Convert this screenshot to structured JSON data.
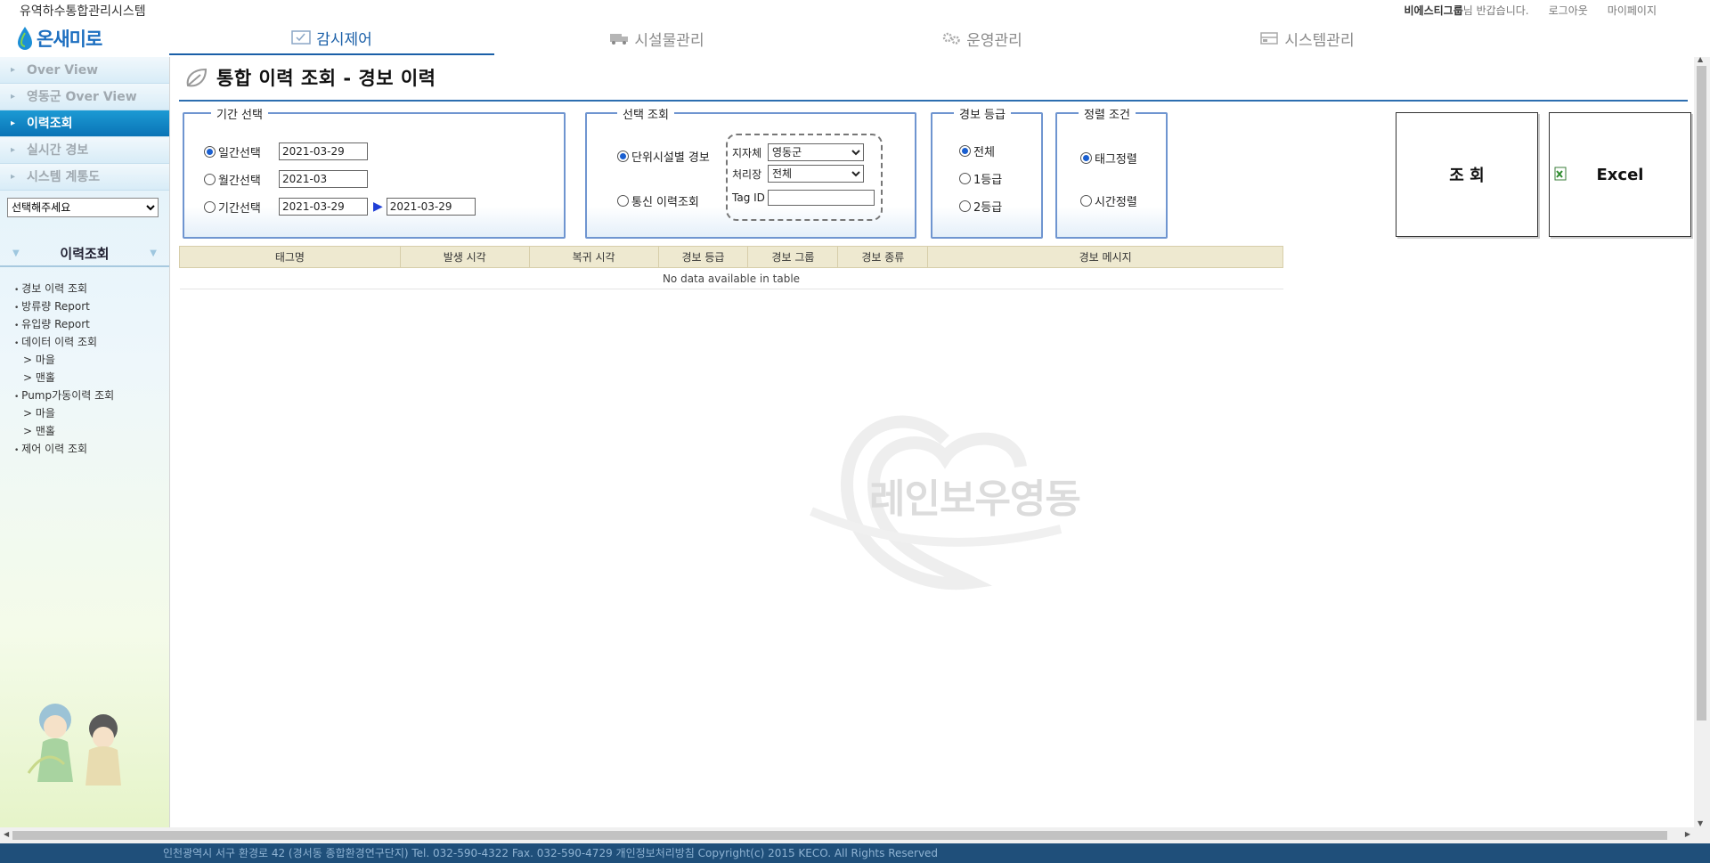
{
  "header": {
    "system_title": "유역하수통합관리시스템",
    "greeting_name": "비에스티그룹",
    "greeting_suffix": "님 반갑습니다.",
    "logout": "로그아웃",
    "mypage": "마이페이지",
    "logo_text": "온새미로"
  },
  "nav": {
    "tabs": [
      {
        "label": "감시제어",
        "icon": "monitor-check-icon",
        "active": true
      },
      {
        "label": "시설물관리",
        "icon": "truck-icon",
        "active": false
      },
      {
        "label": "운영관리",
        "icon": "gears-icon",
        "active": false
      },
      {
        "label": "시스템관리",
        "icon": "server-icon",
        "active": false
      }
    ]
  },
  "sidebar": {
    "items": [
      {
        "label": "Over View"
      },
      {
        "label": "영동군 Over View"
      },
      {
        "label": "이력조회"
      },
      {
        "label": "실시간 경보"
      },
      {
        "label": "시스템 계통도"
      }
    ],
    "select_value": "선택해주세요",
    "section_title": "이력조회",
    "links": [
      {
        "label": "경보 이력 조회",
        "type": "main"
      },
      {
        "label": "방류량 Report",
        "type": "main"
      },
      {
        "label": "유입량 Report",
        "type": "main"
      },
      {
        "label": "데이터 이력 조회",
        "type": "main"
      },
      {
        "label": "> 마을",
        "type": "sub"
      },
      {
        "label": "> 맨홀",
        "type": "sub"
      },
      {
        "label": "Pump가동이력 조회",
        "type": "main"
      },
      {
        "label": "> 마을",
        "type": "sub"
      },
      {
        "label": "> 맨홀",
        "type": "sub"
      },
      {
        "label": "제어 이력 조회",
        "type": "main"
      }
    ]
  },
  "page": {
    "title": "통합 이력 조회 - 경보 이력"
  },
  "period": {
    "legend": "기간 선택",
    "daily_label": "일간선택",
    "daily_value": "2021-03-29",
    "monthly_label": "월간선택",
    "monthly_value": "2021-03",
    "range_label": "기간선택",
    "range_from": "2021-03-29",
    "range_to": "2021-03-29"
  },
  "selection": {
    "legend": "선택 조회",
    "unit_label": "단위시설별 경보",
    "comm_label": "통신 이력조회",
    "region_label": "지자체",
    "region_value": "영동군",
    "plant_label": "처리장",
    "plant_value": "전체",
    "tag_label": "Tag ID",
    "tag_value": ""
  },
  "grade": {
    "legend": "경보 등급",
    "options": [
      "전체",
      "1등급",
      "2등급"
    ]
  },
  "sort": {
    "legend": "정렬 조건",
    "options": [
      "태그정렬",
      "시간정렬"
    ]
  },
  "buttons": {
    "search": "조 회",
    "excel": "Excel"
  },
  "table": {
    "columns": [
      "태그명",
      "발생 시각",
      "복귀 시각",
      "경보 등급",
      "경보 그룹",
      "경보 종류",
      "경보 메시지"
    ],
    "empty": "No data available in table"
  },
  "watermark": "레인보우영동",
  "footer": "인천광역시 서구 환경로 42 (경서동 종합환경연구단지) Tel. 032-590-4322 Fax. 032-590-4729 개인정보처리방침 Copyright(c) 2015 KECO. All Rights Reserved",
  "colors": {
    "accent": "#1a5fa8",
    "sidebar_active": "#0a74b6",
    "footer_bg": "#1f4f7a",
    "box_border": "#6f95d0",
    "table_header": "#eee9d0"
  }
}
